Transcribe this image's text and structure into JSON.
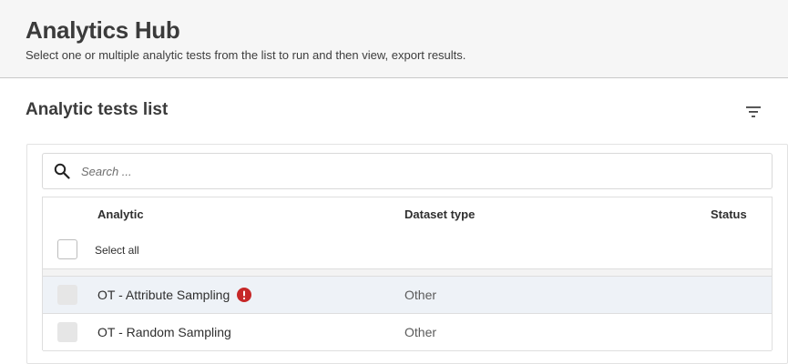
{
  "header": {
    "title": "Analytics Hub",
    "subtitle": "Select one or multiple analytic tests from the list to run and then view, export results."
  },
  "section": {
    "title": "Analytic tests list",
    "filter_icon": "filter-icon"
  },
  "search": {
    "placeholder": "Search ...",
    "value": "",
    "icon": "search-icon"
  },
  "table": {
    "columns": {
      "analytic": "Analytic",
      "dataset_type": "Dataset type",
      "status": "Status"
    },
    "select_all_label": "Select all",
    "rows": [
      {
        "name": "OT - Attribute Sampling",
        "dataset_type": "Other",
        "status": "",
        "has_error": true,
        "highlighted": true
      },
      {
        "name": "OT - Random Sampling",
        "dataset_type": "Other",
        "status": "",
        "has_error": false,
        "highlighted": false
      }
    ]
  },
  "colors": {
    "header_bg": "#f6f6f6",
    "row_highlight": "#eef2f7",
    "error": "#c62828"
  }
}
